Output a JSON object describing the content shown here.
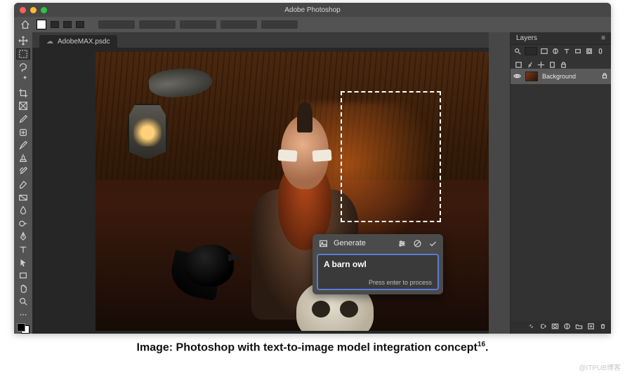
{
  "app": {
    "title": "Adobe Photoshop"
  },
  "document": {
    "tab_label": "AdobeMAX.psdc"
  },
  "generate": {
    "title": "Generate",
    "input_value": "A barn owl",
    "hint": "Press enter to process"
  },
  "layers_panel": {
    "tab": "Layers",
    "background_label": "Background"
  },
  "caption": {
    "prefix": "Image: ",
    "text": "Photoshop with text-to-image model integration concept",
    "sup": "16",
    "suffix": "."
  },
  "watermark": "@ITPUB博客"
}
